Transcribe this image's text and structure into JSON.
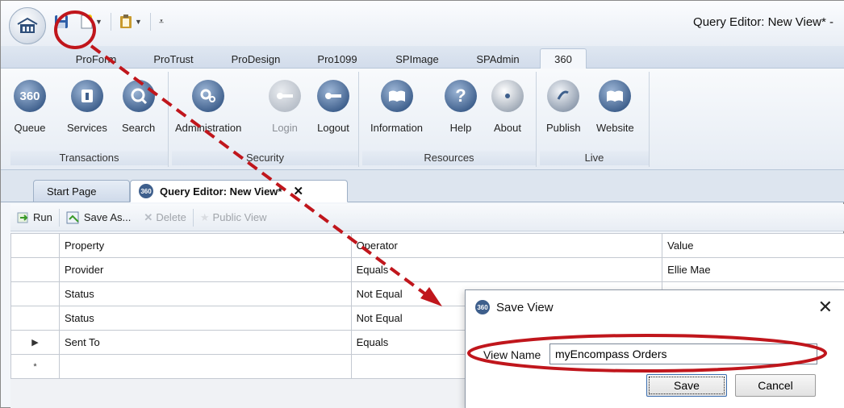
{
  "window": {
    "title": "Query Editor: New View* -"
  },
  "ribbon_tabs": [
    "ProForm",
    "ProTrust",
    "ProDesign",
    "Pro1099",
    "SPImage",
    "SPAdmin",
    "360"
  ],
  "ribbon_groups": {
    "transactions": {
      "label": "Transactions",
      "buttons": [
        "Queue",
        "Services",
        "Search"
      ],
      "icon_text": "360"
    },
    "security": {
      "label": "Security",
      "buttons": [
        "Administration",
        "Login",
        "Logout"
      ]
    },
    "resources": {
      "label": "Resources",
      "buttons": [
        "Information",
        "Help",
        "About"
      ]
    },
    "live": {
      "label": "Live",
      "buttons": [
        "Publish",
        "Website"
      ]
    }
  },
  "doc_tabs": {
    "start": "Start Page",
    "query": "Query Editor: New View*",
    "close": "✕",
    "badge": "360"
  },
  "toolbar": {
    "run": "Run",
    "save_as": "Save As...",
    "delete": "Delete",
    "public_view": "Public View"
  },
  "grid": {
    "columns": [
      "Property",
      "Operator",
      "Value"
    ],
    "rows": [
      {
        "indicator": "",
        "property": "Provider",
        "operator": "Equals",
        "value": "Ellie Mae"
      },
      {
        "indicator": "",
        "property": "Status",
        "operator": "Not Equal",
        "value": ""
      },
      {
        "indicator": "",
        "property": "Status",
        "operator": "Not Equal",
        "value": ""
      },
      {
        "indicator": "▶",
        "property": "Sent To",
        "operator": "Equals",
        "value": ""
      },
      {
        "indicator": "*",
        "property": "",
        "operator": "",
        "value": ""
      }
    ]
  },
  "dialog": {
    "title": "Save View",
    "badge": "360",
    "close": "✕",
    "view_name_label": "View Name",
    "view_name_value": "myEncompass Orders",
    "save": "Save",
    "cancel": "Cancel"
  },
  "annotation": {
    "color": "#c0161c"
  }
}
